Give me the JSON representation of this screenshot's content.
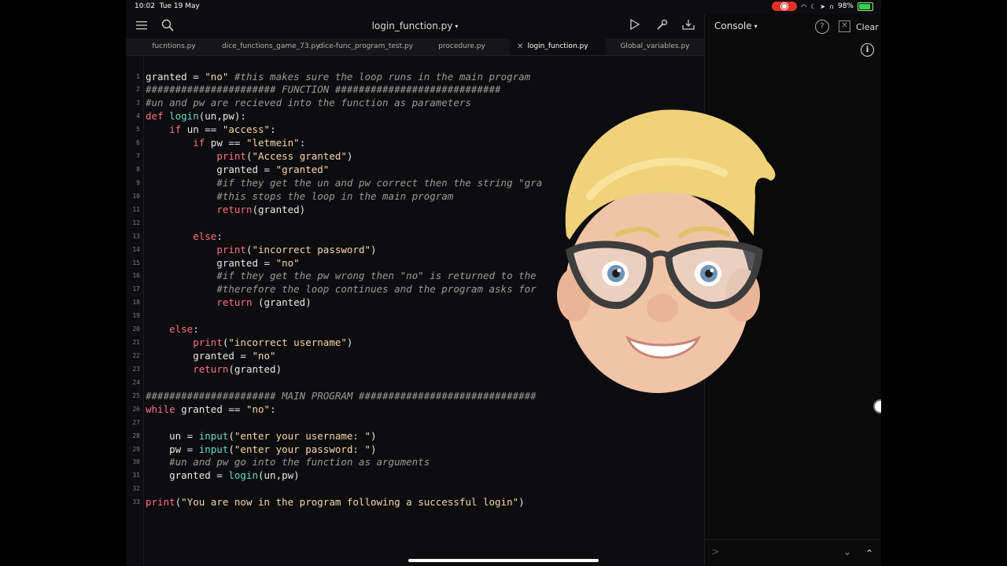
{
  "status_bar": {
    "time": "10:02",
    "date": "Tue 19 May",
    "battery": "98%",
    "battery_level": 0.98
  },
  "editor": {
    "file_title": "login_function.py",
    "tabs": [
      {
        "label": "fucntions.py",
        "active": false
      },
      {
        "label": "dice_functions_game_73.py",
        "active": false
      },
      {
        "label": "dice-func_program_test.py",
        "active": false
      },
      {
        "label": "procedure.py",
        "active": false
      },
      {
        "label": "login_function.py",
        "active": true
      },
      {
        "label": "Global_variables.py",
        "active": false
      }
    ],
    "line_numbers": [
      "1",
      "2",
      "3",
      "4",
      "5",
      "6",
      "7",
      "8",
      "9",
      "10",
      "11",
      "12",
      "13",
      "14",
      "15",
      "16",
      "17",
      "18",
      "19",
      "20",
      "21",
      "22",
      "23",
      "24",
      "25",
      "26",
      "27",
      "28",
      "29",
      "30",
      "31",
      "32",
      "33"
    ],
    "code_lines": [
      [
        {
          "t": "granted = "
        },
        {
          "t": "\"no\"",
          "c": "st"
        },
        {
          "t": " #this makes sure the loop runs in the main program",
          "c": "cm"
        }
      ],
      [
        {
          "t": "###################### FUNCTION ############################",
          "c": "cm"
        }
      ],
      [
        {
          "t": "#un and pw are recieved into the function as parameters",
          "c": "cm"
        }
      ],
      [
        {
          "t": "def",
          "c": "kw"
        },
        {
          "t": " "
        },
        {
          "t": "login",
          "c": "fn"
        },
        {
          "t": "(un,pw):"
        }
      ],
      [
        {
          "t": "    "
        },
        {
          "t": "if",
          "c": "kw"
        },
        {
          "t": " un == "
        },
        {
          "t": "\"access\"",
          "c": "st"
        },
        {
          "t": ":"
        }
      ],
      [
        {
          "t": "        "
        },
        {
          "t": "if",
          "c": "kw"
        },
        {
          "t": " pw == "
        },
        {
          "t": "\"letmein\"",
          "c": "st"
        },
        {
          "t": ":"
        }
      ],
      [
        {
          "t": "            "
        },
        {
          "t": "print",
          "c": "kw"
        },
        {
          "t": "("
        },
        {
          "t": "\"Access granted\"",
          "c": "st"
        },
        {
          "t": ")"
        }
      ],
      [
        {
          "t": "            granted = "
        },
        {
          "t": "\"granted\"",
          "c": "st"
        }
      ],
      [
        {
          "t": "            "
        },
        {
          "t": "#if they get the un and pw correct then the string \"gra",
          "c": "cm"
        }
      ],
      [
        {
          "t": "            "
        },
        {
          "t": "#this stops the loop in the main program",
          "c": "cm"
        }
      ],
      [
        {
          "t": "            "
        },
        {
          "t": "return",
          "c": "kw"
        },
        {
          "t": "(granted)"
        }
      ],
      [],
      [
        {
          "t": "        "
        },
        {
          "t": "else",
          "c": "kw"
        },
        {
          "t": ":"
        }
      ],
      [
        {
          "t": "            "
        },
        {
          "t": "print",
          "c": "kw"
        },
        {
          "t": "("
        },
        {
          "t": "\"incorrect password\"",
          "c": "st"
        },
        {
          "t": ")"
        }
      ],
      [
        {
          "t": "            granted = "
        },
        {
          "t": "\"no\"",
          "c": "st"
        }
      ],
      [
        {
          "t": "            "
        },
        {
          "t": "#if they get the pw wrong then \"no\" is returned to the",
          "c": "cm"
        }
      ],
      [
        {
          "t": "            "
        },
        {
          "t": "#therefore the loop continues and the program asks for",
          "c": "cm"
        }
      ],
      [
        {
          "t": "            "
        },
        {
          "t": "return",
          "c": "kw"
        },
        {
          "t": " (granted)"
        }
      ],
      [],
      [
        {
          "t": "    "
        },
        {
          "t": "else",
          "c": "kw"
        },
        {
          "t": ":"
        }
      ],
      [
        {
          "t": "        "
        },
        {
          "t": "print",
          "c": "kw"
        },
        {
          "t": "("
        },
        {
          "t": "\"incorrect username\"",
          "c": "st"
        },
        {
          "t": ")"
        }
      ],
      [
        {
          "t": "        granted = "
        },
        {
          "t": "\"no\"",
          "c": "st"
        }
      ],
      [
        {
          "t": "        "
        },
        {
          "t": "return",
          "c": "kw"
        },
        {
          "t": "(granted)"
        }
      ],
      [],
      [
        {
          "t": "###################### MAIN PROGRAM ##############################",
          "c": "cm"
        }
      ],
      [
        {
          "t": "while",
          "c": "kw"
        },
        {
          "t": " granted == "
        },
        {
          "t": "\"no\"",
          "c": "st"
        },
        {
          "t": ":"
        }
      ],
      [],
      [
        {
          "t": "    un = "
        },
        {
          "t": "input",
          "c": "fn"
        },
        {
          "t": "("
        },
        {
          "t": "\"enter your username: \"",
          "c": "st"
        },
        {
          "t": ")"
        }
      ],
      [
        {
          "t": "    pw = "
        },
        {
          "t": "input",
          "c": "fn"
        },
        {
          "t": "("
        },
        {
          "t": "\"enter your password: \"",
          "c": "st"
        },
        {
          "t": ")"
        }
      ],
      [
        {
          "t": "    "
        },
        {
          "t": "#un and pw go into the function as arguments",
          "c": "cm"
        }
      ],
      [
        {
          "t": "    granted = "
        },
        {
          "t": "login",
          "c": "fn"
        },
        {
          "t": "(un,pw)"
        }
      ],
      [],
      [
        {
          "t": "print",
          "c": "kw"
        },
        {
          "t": "("
        },
        {
          "t": "\"You are now in the program following a successful login\"",
          "c": "st"
        },
        {
          "t": ")"
        }
      ]
    ]
  },
  "console": {
    "title": "Console",
    "clear_label": "Clear",
    "prompt": ">"
  },
  "icons": {
    "menu": "menu-icon",
    "search": "search-icon",
    "run": "play-icon",
    "tools": "wrench-icon",
    "download": "download-icon",
    "help": "help-icon",
    "close": "close-icon",
    "info": "info-icon"
  },
  "colors": {
    "keyword": "#ff6f83",
    "function": "#66d9c9",
    "string": "#f7d7a6",
    "comment": "#9a9a9a",
    "record": "#e0302a",
    "battery": "#3ecf4a"
  }
}
